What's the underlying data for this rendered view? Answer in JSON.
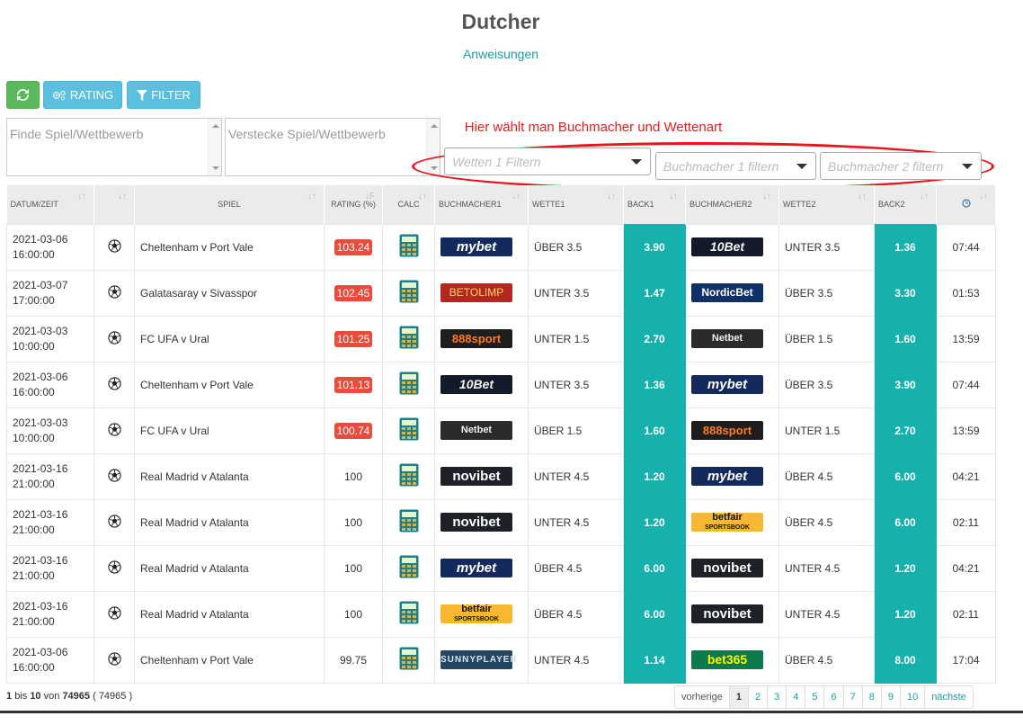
{
  "header": {
    "title": "Dutcher",
    "instructions": "Anweisungen"
  },
  "toolbar": {
    "rating_label": "RATING",
    "filter_label": "FILTER"
  },
  "search": {
    "find_placeholder": "Finde Spiel/Wettbewerb",
    "hide_placeholder": "Verstecke Spiel/Wettbewerb"
  },
  "annotation": "Hier wählt man Buchmacher und Wettenart",
  "filters": {
    "bets1": "Wetten 1 Filtern",
    "bookmaker1": "Buchmacher 1 filtern",
    "bookmaker2": "Buchmacher 2 filtern"
  },
  "columns": [
    "DATUM/ZEIT",
    "",
    "SPIEL",
    "RATING (%)",
    "CALC",
    "BUCHMACHER1",
    "WETTE1",
    "BACK1",
    "BUCHMACHER2",
    "WETTE2",
    "BACK2",
    ""
  ],
  "rows": [
    {
      "date": "2021-03-06",
      "time": "16:00:00",
      "match": "Cheltenham v Port Vale",
      "rating": "103.24",
      "badge": true,
      "bm1": "mybet",
      "bet1": "ÜBER 3.5",
      "back1": "3.90",
      "bm2": "10Bet",
      "bet2": "UNTER 3.5",
      "back2": "1.36",
      "ttl": "07:44"
    },
    {
      "date": "2021-03-07",
      "time": "17:00:00",
      "match": "Galatasaray v Sivasspor",
      "rating": "102.45",
      "badge": true,
      "bm1": "BETOLIMP",
      "bet1": "UNTER 3.5",
      "back1": "1.47",
      "bm2": "NordicBet",
      "bet2": "ÜBER 3.5",
      "back2": "3.30",
      "ttl": "01:53"
    },
    {
      "date": "2021-03-03",
      "time": "10:00:00",
      "match": "FC UFA v Ural",
      "rating": "101.25",
      "badge": true,
      "bm1": "888sport",
      "bet1": "UNTER 1.5",
      "back1": "2.70",
      "bm2": "Netbet",
      "bet2": "ÜBER 1.5",
      "back2": "1.60",
      "ttl": "13:59"
    },
    {
      "date": "2021-03-06",
      "time": "16:00:00",
      "match": "Cheltenham v Port Vale",
      "rating": "101.13",
      "badge": true,
      "bm1": "10Bet",
      "bet1": "UNTER 3.5",
      "back1": "1.36",
      "bm2": "mybet",
      "bet2": "ÜBER 3.5",
      "back2": "3.90",
      "ttl": "07:44"
    },
    {
      "date": "2021-03-03",
      "time": "10:00:00",
      "match": "FC UFA v Ural",
      "rating": "100.74",
      "badge": true,
      "bm1": "Netbet",
      "bet1": "ÜBER 1.5",
      "back1": "1.60",
      "bm2": "888sport",
      "bet2": "UNTER 1.5",
      "back2": "2.70",
      "ttl": "13:59"
    },
    {
      "date": "2021-03-16",
      "time": "21:00:00",
      "match": "Real Madrid v Atalanta",
      "rating": "100",
      "badge": false,
      "bm1": "novibet",
      "bet1": "UNTER 4.5",
      "back1": "1.20",
      "bm2": "mybet",
      "bet2": "ÜBER 4.5",
      "back2": "6.00",
      "ttl": "04:21"
    },
    {
      "date": "2021-03-16",
      "time": "21:00:00",
      "match": "Real Madrid v Atalanta",
      "rating": "100",
      "badge": false,
      "bm1": "novibet",
      "bet1": "UNTER 4.5",
      "back1": "1.20",
      "bm2": "betfair",
      "bet2": "ÜBER 4.5",
      "back2": "6.00",
      "ttl": "02:11"
    },
    {
      "date": "2021-03-16",
      "time": "21:00:00",
      "match": "Real Madrid v Atalanta",
      "rating": "100",
      "badge": false,
      "bm1": "mybet",
      "bet1": "ÜBER 4.5",
      "back1": "6.00",
      "bm2": "novibet",
      "bet2": "UNTER 4.5",
      "back2": "1.20",
      "ttl": "04:21"
    },
    {
      "date": "2021-03-16",
      "time": "21:00:00",
      "match": "Real Madrid v Atalanta",
      "rating": "100",
      "badge": false,
      "bm1": "betfair",
      "bet1": "ÜBER 4.5",
      "back1": "6.00",
      "bm2": "novibet",
      "bet2": "UNTER 4.5",
      "back2": "1.20",
      "ttl": "02:11"
    },
    {
      "date": "2021-03-06",
      "time": "16:00:00",
      "match": "Cheltenham v Port Vale",
      "rating": "99.75",
      "badge": false,
      "bm1": "SUNNYPLAYER",
      "bet1": "UNTER 4.5",
      "back1": "1.14",
      "bm2": "bet365",
      "bet2": "ÜBER 4.5",
      "back2": "8.00",
      "ttl": "17:04"
    }
  ],
  "footer": {
    "from": "1",
    "bis": "bis",
    "to": "10",
    "von": "von",
    "total": "74965",
    "total_paren": "( 74965 )"
  },
  "pagination": {
    "prev": "vorherige",
    "pages": [
      "1",
      "2",
      "3",
      "4",
      "5",
      "6",
      "7",
      "8",
      "9",
      "10"
    ],
    "next": "nächste",
    "active": "1"
  },
  "colors": {
    "accent": "#16b1ac",
    "badge": "#e74c3c",
    "annotation": "#e8161b"
  }
}
